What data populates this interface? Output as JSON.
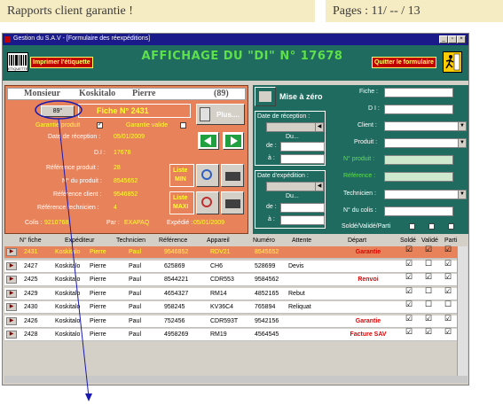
{
  "banner": {
    "title": "Rapports client garantie !",
    "pages": "Pages : 11/ -- / 13"
  },
  "window": {
    "title": "Gestion du S.A.V - [Formulaire des réexpéditions]",
    "buttons": [
      "_",
      "▫",
      "×"
    ]
  },
  "header": {
    "print_label": "Imprimer  l'étiquette",
    "barcode_caption": "ETIQUETTE",
    "title": "AFFICHAGE DU \"DI\" N° 17678",
    "quit_label": "Quitter le formulaire"
  },
  "client": {
    "civility": "Monsieur",
    "name": "Koskitalo",
    "firstname": "Pierre",
    "dept": "(89)"
  },
  "fiche": {
    "circle_value": "89°",
    "label": "Fiche N° 2431",
    "plus_label": "Plus....",
    "garantie_produit": "Garantie produit",
    "garantie_valide": "Garantie valide",
    "date_reception_label": "Date de réception :",
    "date_reception": "05/01/2009",
    "di_label": "D.I :",
    "di": "17678",
    "ref_produit_label": "Référence produit :",
    "ref_produit": "28",
    "num_produit_label": "N° du produit :",
    "num_produit": "8545652",
    "ref_client_label": "Référence client :",
    "ref_client": "9546852",
    "ref_tech_label": "Référence technicien :",
    "ref_tech": "4",
    "colis_label": "Colis :",
    "colis": "9210768",
    "par_label": "Par :",
    "par": "EXAPAQ",
    "expedie_label": "Expédié :",
    "expedie": "05/01/2009",
    "liste_label": "Liste",
    "min_label": "MIN",
    "liste2_label": "Liste",
    "maxi_label": "MAXI"
  },
  "filters": {
    "reset_label": "Mise à zéro",
    "date_reception_label": "Date de réception :",
    "du_label": "Du...",
    "de_label": "de :",
    "a_label": "à :",
    "date_expedition_label": "Date d'expédition :",
    "fiche_label": "Fiche :",
    "di_label": "D I :",
    "client_label": "Client :",
    "produit_label": "Produit :",
    "num_produit_label": "N° produit :",
    "reference_label": "Référence :",
    "technicien_label": "Technicien :",
    "colis_label": "N° du colis :",
    "solde_label": "Soldé/Validé/Parti"
  },
  "table": {
    "headers": [
      "N° fiche",
      "Expéditeur",
      "Technicien",
      "Référence",
      "Appareil",
      "Numéro",
      "Attente",
      "Départ",
      "Soldé",
      "Validé",
      "Parti"
    ],
    "rows": [
      {
        "fiche": "2431",
        "exp": "Koskitalo",
        "prenom": "Pierre",
        "tech": "Paul",
        "ref": "9546852",
        "app": "RDV21",
        "num": "8545652",
        "att": "",
        "dep": "Garantie",
        "s": "☑",
        "v": "☑",
        "p": "☑"
      },
      {
        "fiche": "2427",
        "exp": "Koskitalo",
        "prenom": "Pierre",
        "tech": "Paul",
        "ref": "625869",
        "app": "CH6",
        "num": "528699",
        "att": "Devis",
        "dep": "",
        "s": "☑",
        "v": "☐",
        "p": "☑"
      },
      {
        "fiche": "2425",
        "exp": "Koskitalo",
        "prenom": "Pierre",
        "tech": "Paul",
        "ref": "8544221",
        "app": "CDR553",
        "num": "9584562",
        "att": "",
        "dep": "Renvoi",
        "s": "☑",
        "v": "☑",
        "p": "☑"
      },
      {
        "fiche": "2429",
        "exp": "Koskitalo",
        "prenom": "Pierre",
        "tech": "Paul",
        "ref": "4654327",
        "app": "RM14",
        "num": "4852165",
        "att": "Rebut",
        "dep": "",
        "s": "☑",
        "v": "☐",
        "p": "☑"
      },
      {
        "fiche": "2430",
        "exp": "Koskitalo",
        "prenom": "Pierre",
        "tech": "Paul",
        "ref": "958245",
        "app": "KV36C4",
        "num": "765894",
        "att": "Reliquat",
        "dep": "",
        "s": "☑",
        "v": "☐",
        "p": "☐"
      },
      {
        "fiche": "2426",
        "exp": "Koskitalo",
        "prenom": "Pierre",
        "tech": "Paul",
        "ref": "752456",
        "app": "CDR593T",
        "num": "9542156",
        "att": "",
        "dep": "Garantie",
        "s": "☑",
        "v": "☑",
        "p": "☑"
      },
      {
        "fiche": "2428",
        "exp": "Koskitalo",
        "prenom": "Pierre",
        "tech": "Paul",
        "ref": "4958269",
        "app": "RM19",
        "num": "4564545",
        "att": "",
        "dep": "Facture SAV",
        "s": "☑",
        "v": "☑",
        "p": "☑"
      }
    ]
  },
  "colors": {
    "accent": "#e8825a",
    "teal": "#1f6b5f",
    "title_green": "#5ee04a",
    "arrow": "#1a1ab0"
  }
}
